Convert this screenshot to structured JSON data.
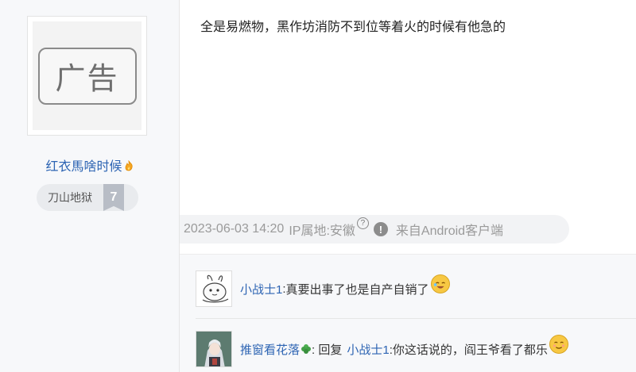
{
  "author": {
    "avatar_placeholder": "广告",
    "name": "红衣馬啥时候",
    "level_name": "刀山地狱",
    "level_num": "7"
  },
  "post": {
    "content": "全是易燃物，黑作坊消防不到位等着火的时候有他急的"
  },
  "meta": {
    "datetime": "2023-06-03 14:20",
    "ip": "IP属地:安徽",
    "help": "?",
    "warn": "!",
    "source": "来自Android客户端"
  },
  "replies": [
    {
      "name": "小战士1",
      "sep": ": ",
      "text": "真要出事了也是自产自销了"
    },
    {
      "name": "推窗看花落",
      "sep": ": 回复",
      "mention": "小战士1",
      "text": " :你这话说的，阎王爷看了都乐"
    }
  ],
  "colors": {
    "link": "#2d64b3",
    "meta": "#9a9a9a"
  }
}
